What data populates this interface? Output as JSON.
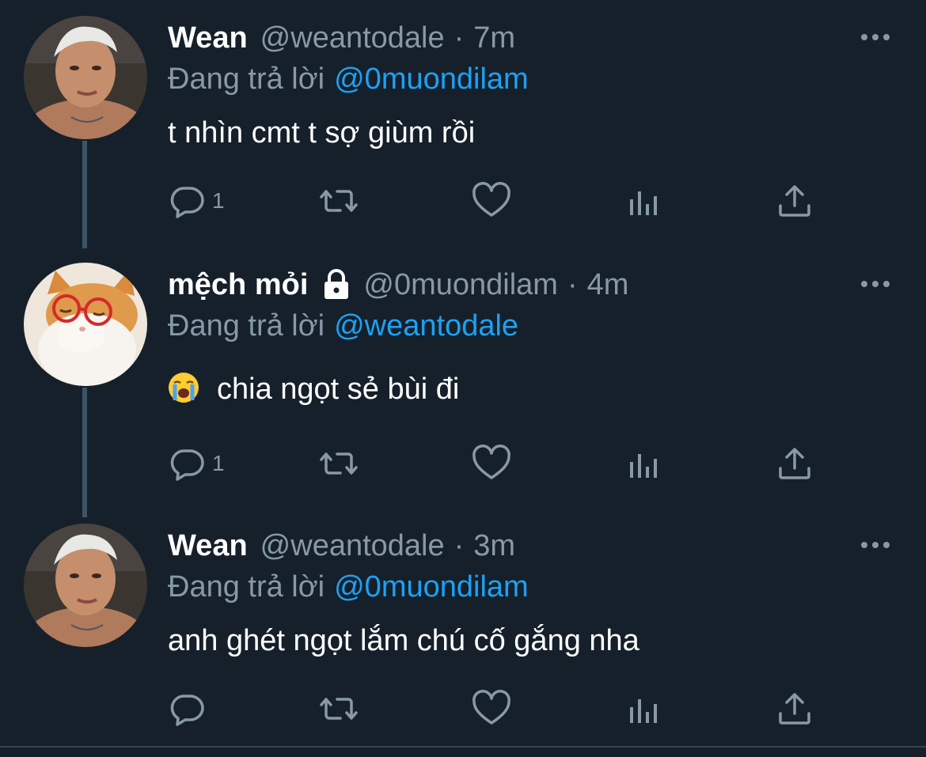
{
  "tweets": [
    {
      "name": "Wean",
      "handle": "@weantodale",
      "time": "7m",
      "reply_label": "Đang trả lời",
      "reply_mention": "@0muondilam",
      "text": "t nhìn cmt t sợ giùm rồi",
      "reply_count": "1",
      "avatar": "person-avatar",
      "locked": false
    },
    {
      "name": "mệch mỏi",
      "handle": "@0muondilam",
      "time": "4m",
      "reply_label": "Đang trả lời",
      "reply_mention": "@weantodale",
      "text": "chia ngọt sẻ bùi đi",
      "text_emoji": "crying-face-emoji",
      "reply_count": "1",
      "avatar": "cat-avatar",
      "locked": true
    },
    {
      "name": "Wean",
      "handle": "@weantodale",
      "time": "3m",
      "reply_label": "Đang trả lời",
      "reply_mention": "@0muondilam",
      "text": "anh ghét ngọt lắm chú cố gắng nha",
      "reply_count": "",
      "avatar": "person-avatar",
      "locked": false
    }
  ],
  "separator": "·",
  "colors": {
    "background": "#15202b",
    "secondary_text": "#8899a6",
    "mention": "#1da1f2",
    "thread_line": "#3d5466"
  },
  "icons": [
    "reply-icon",
    "retweet-icon",
    "like-icon",
    "analytics-icon",
    "share-icon",
    "more-icon",
    "lock-icon"
  ]
}
